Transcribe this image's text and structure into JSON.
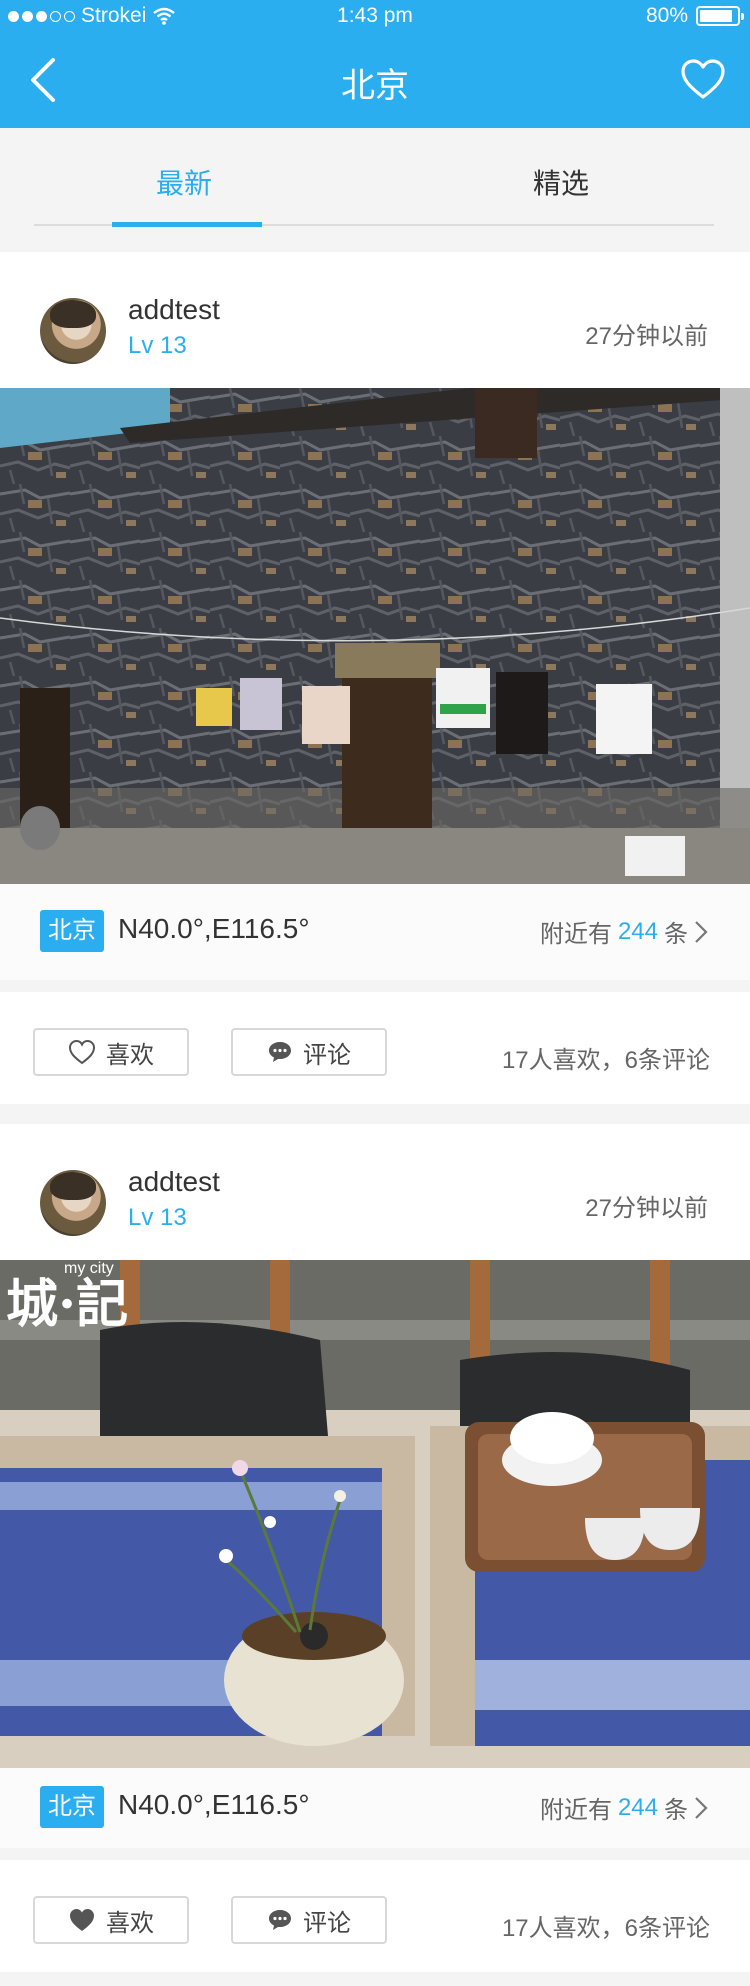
{
  "status": {
    "carrier": "Strokei",
    "time": "1:43 pm",
    "battery": "80%"
  },
  "nav": {
    "title": "北京"
  },
  "tabs": [
    {
      "label": "最新",
      "active": true
    },
    {
      "label": "精选",
      "active": false
    }
  ],
  "posts": [
    {
      "username": "addtest",
      "level": "Lv 13",
      "time": "27分钟以前",
      "city": "北京",
      "coords": "N40.0°,E116.5°",
      "nearby_prefix": "附近有",
      "nearby_count": "244",
      "nearby_suffix": "条",
      "like_label": "喜欢",
      "comment_label": "评论",
      "stats": "17人喜欢，6条评论",
      "liked": false
    },
    {
      "username": "addtest",
      "level": "Lv 13",
      "time": "27分钟以前",
      "city": "北京",
      "coords": "N40.0°,E116.5°",
      "nearby_prefix": "附近有",
      "nearby_count": "244",
      "nearby_suffix": "条",
      "like_label": "喜欢",
      "comment_label": "评论",
      "stats": "17人喜欢，6条评论",
      "liked": true,
      "photo_watermark": {
        "main": "城·記",
        "sub": "my city"
      }
    }
  ],
  "colors": {
    "accent": "#2aaef0",
    "background": "#f4f4f4"
  }
}
